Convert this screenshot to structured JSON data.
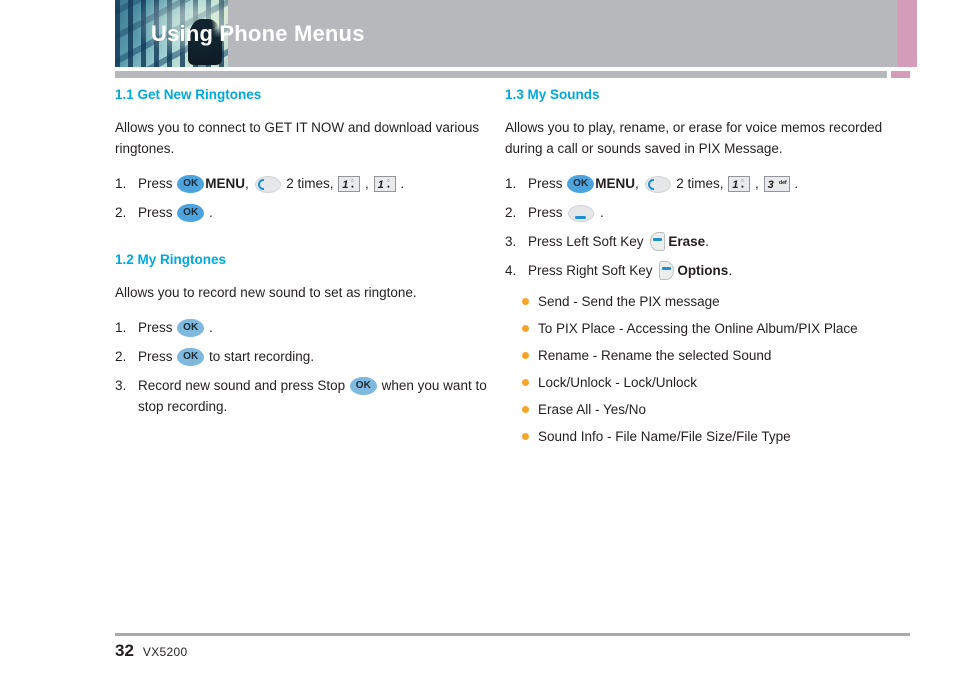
{
  "header": {
    "title": "Using Phone Menus",
    "band_color": "#b6b8bb",
    "accent_color": "#d49cb8",
    "title_color": "#ffffff"
  },
  "theme": {
    "heading_color": "#00a9dd",
    "bullet_color": "#f7a42b",
    "key_blue": "#4da3dd",
    "key_blue_light": "#7fb9de",
    "key_accent": "#1f8fd0",
    "text_color": "#231f20"
  },
  "left_column": {
    "sections": [
      {
        "heading": "1.1 Get New Ringtones",
        "description": "Allows you to connect to GET IT NOW and download various ringtones.",
        "steps": [
          {
            "num": "1.",
            "parts": [
              {
                "t": "text",
                "v": "Press "
              },
              {
                "t": "key-ok",
                "v": "OK",
                "style": "solid"
              },
              {
                "t": "bold",
                "v": "MENU"
              },
              {
                "t": "text",
                "v": ", "
              },
              {
                "t": "key-nav",
                "v": "navigation-left-key"
              },
              {
                "t": "text",
                "v": " 2 times, "
              },
              {
                "t": "key-num",
                "v": "1",
                "sub": "°·"
              },
              {
                "t": "text",
                "v": " , "
              },
              {
                "t": "key-num",
                "v": "1",
                "sub": "°·"
              },
              {
                "t": "text",
                "v": " ."
              }
            ]
          },
          {
            "num": "2.",
            "parts": [
              {
                "t": "text",
                "v": "Press "
              },
              {
                "t": "key-ok",
                "v": "OK",
                "style": "solid"
              },
              {
                "t": "text",
                "v": " ."
              }
            ]
          }
        ]
      },
      {
        "heading": "1.2 My Ringtones",
        "description": "Allows you to record new sound to set as ringtone.",
        "steps": [
          {
            "num": "1.",
            "parts": [
              {
                "t": "text",
                "v": "Press "
              },
              {
                "t": "key-ok",
                "v": "OK",
                "style": "light"
              },
              {
                "t": "text",
                "v": " ."
              }
            ]
          },
          {
            "num": "2.",
            "parts": [
              {
                "t": "text",
                "v": "Press "
              },
              {
                "t": "key-ok",
                "v": "OK",
                "style": "light"
              },
              {
                "t": "text",
                "v": " to start recording."
              }
            ]
          },
          {
            "num": "3.",
            "parts": [
              {
                "t": "text",
                "v": "Record new sound and press Stop "
              },
              {
                "t": "key-ok",
                "v": "OK",
                "style": "light"
              },
              {
                "t": "text",
                "v": " when you want to stop recording."
              }
            ]
          }
        ]
      }
    ]
  },
  "right_column": {
    "sections": [
      {
        "heading": "1.3 My Sounds",
        "description": "Allows you to play, rename, or erase for voice memos recorded during a call or sounds saved in PIX Message.",
        "steps": [
          {
            "num": "1.",
            "parts": [
              {
                "t": "text",
                "v": "Press "
              },
              {
                "t": "key-ok",
                "v": "OK",
                "style": "solid"
              },
              {
                "t": "bold",
                "v": "MENU"
              },
              {
                "t": "text",
                "v": ", "
              },
              {
                "t": "key-nav",
                "v": "navigation-left-key"
              },
              {
                "t": "text",
                "v": " 2 times, "
              },
              {
                "t": "key-num",
                "v": "1",
                "sub": "°·"
              },
              {
                "t": "text",
                "v": " , "
              },
              {
                "t": "key-num3",
                "v": "3",
                "def": "def"
              },
              {
                "t": "text",
                "v": " ."
              }
            ]
          },
          {
            "num": "2.",
            "parts": [
              {
                "t": "text",
                "v": "Press "
              },
              {
                "t": "key-clear",
                "v": "clear-key"
              },
              {
                "t": "text",
                "v": " ."
              }
            ]
          },
          {
            "num": "3.",
            "parts": [
              {
                "t": "text",
                "v": "Press Left Soft Key "
              },
              {
                "t": "key-soft-left",
                "v": "left-soft-key"
              },
              {
                "t": "bold",
                "v": "Erase"
              },
              {
                "t": "text",
                "v": "."
              }
            ]
          },
          {
            "num": "4.",
            "parts": [
              {
                "t": "text",
                "v": "Press Right Soft Key "
              },
              {
                "t": "key-soft-right",
                "v": "right-soft-key"
              },
              {
                "t": "bold",
                "v": "Options"
              },
              {
                "t": "text",
                "v": "."
              }
            ]
          }
        ],
        "bullets": [
          "Send - Send the PIX message",
          "To PIX Place - Accessing the Online Album/PIX Place",
          "Rename - Rename the selected Sound",
          "Lock/Unlock - Lock/Unlock",
          "Erase All - Yes/No",
          "Sound Info - File Name/File Size/File Type"
        ]
      }
    ]
  },
  "footer": {
    "page_number": "32",
    "model": "VX5200"
  }
}
